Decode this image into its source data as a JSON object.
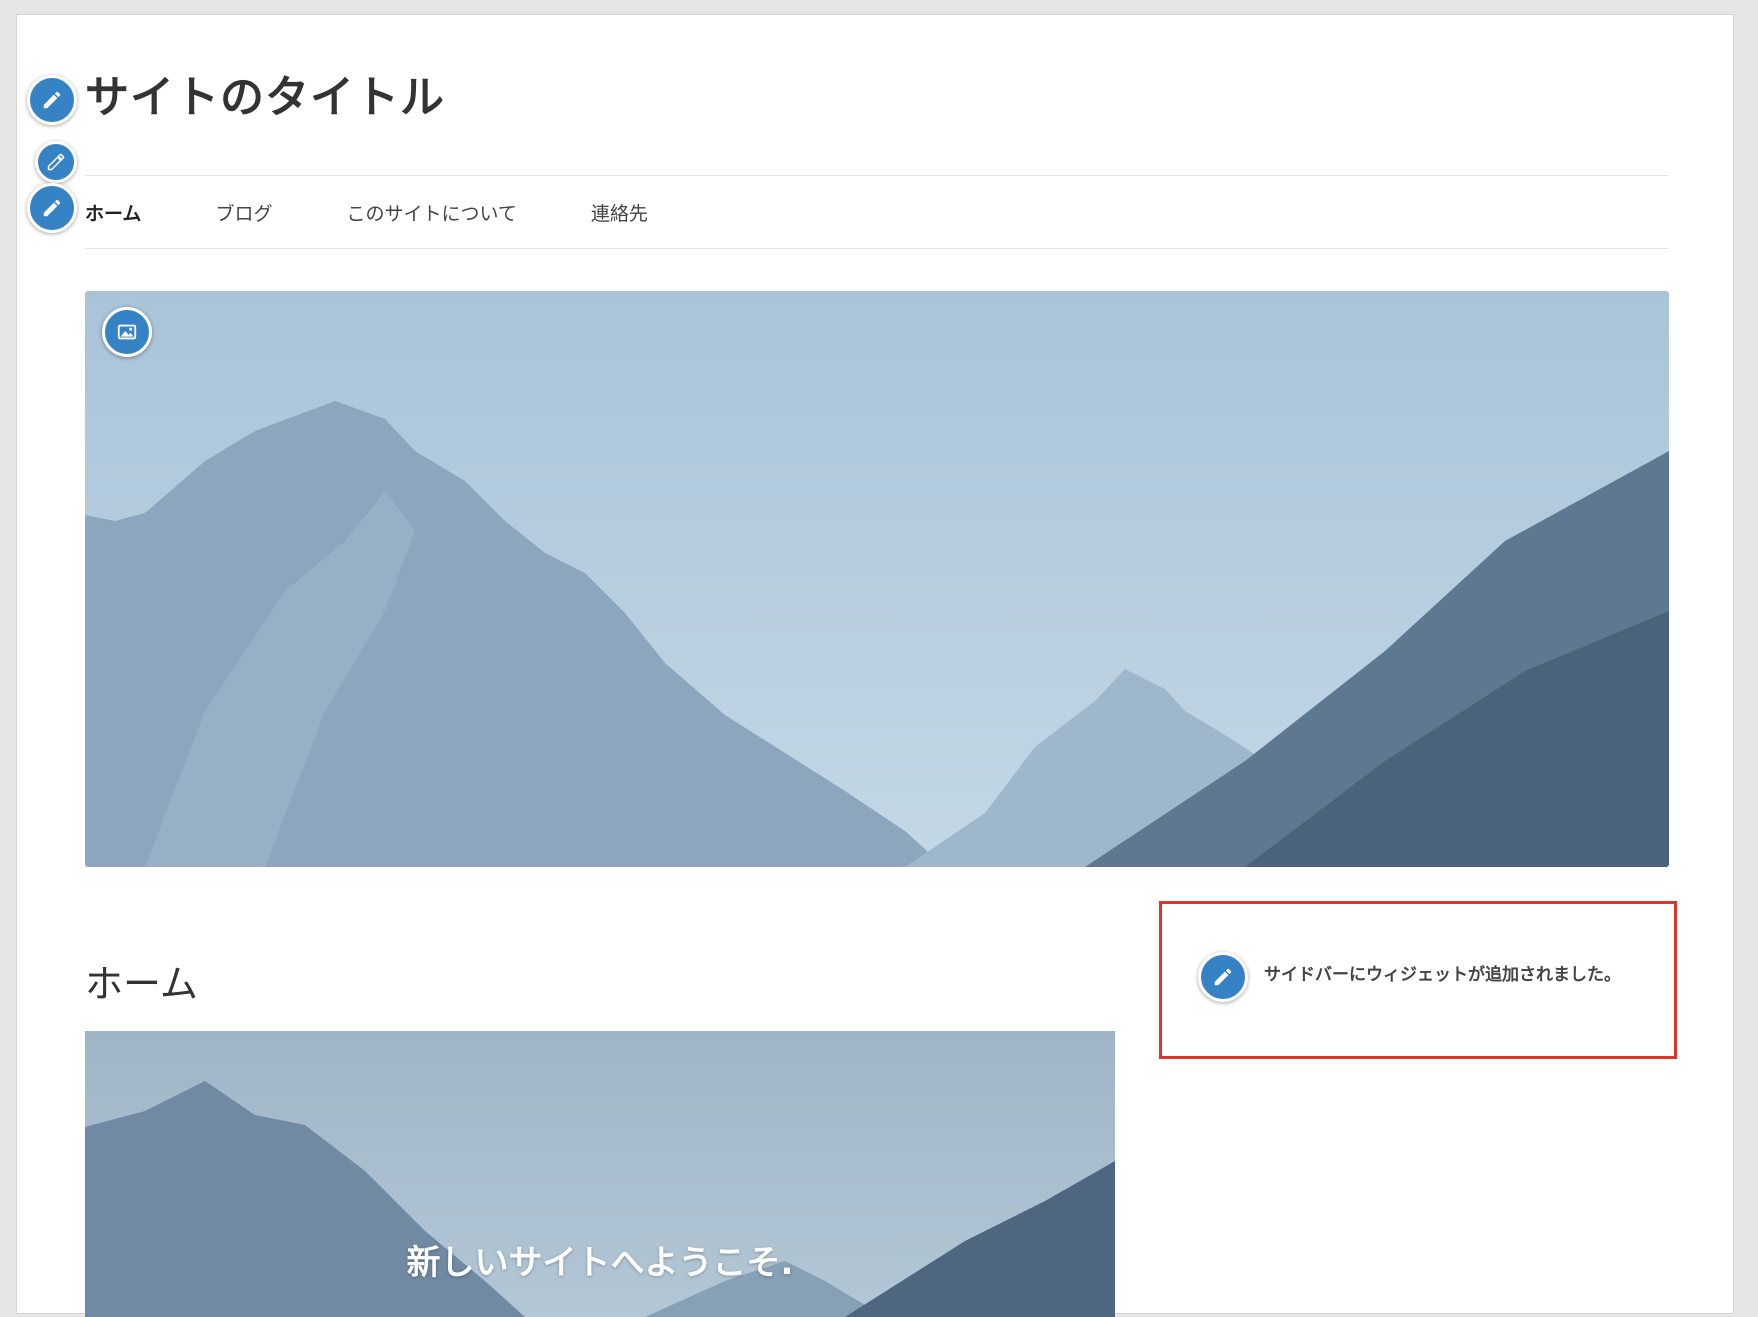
{
  "site": {
    "title": "サイトのタイトル"
  },
  "nav": {
    "items": [
      {
        "label": "ホーム",
        "current": true
      },
      {
        "label": "ブログ"
      },
      {
        "label": "このサイトについて"
      },
      {
        "label": "連絡先"
      }
    ]
  },
  "page": {
    "heading": "ホーム",
    "cover_text": "新しいサイトへようこそ."
  },
  "sidebar": {
    "widget_text": "サイドバーにウィジェットが追加されました。"
  },
  "icons": {
    "edit": "pencil-icon",
    "media": "image-icon"
  },
  "colors": {
    "edit_button": "#3582c4",
    "highlight_border": "#e0352b"
  }
}
